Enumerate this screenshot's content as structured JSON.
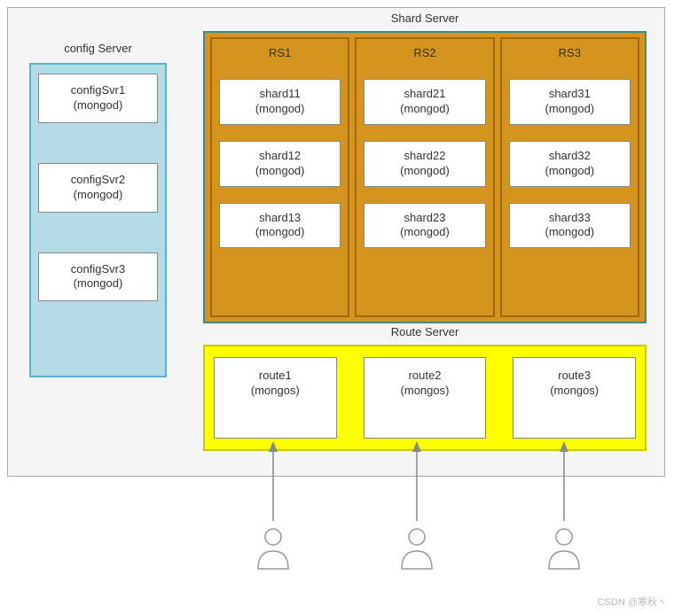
{
  "sections": {
    "config_title": "config Server",
    "shard_title": "Shard Server",
    "route_title": "Route Server"
  },
  "config_servers": [
    {
      "name": "configSvr1",
      "proc": "(mongod)"
    },
    {
      "name": "configSvr2",
      "proc": "(mongod)"
    },
    {
      "name": "configSvr3",
      "proc": "(mongod)"
    }
  ],
  "replica_sets": [
    {
      "label": "RS1",
      "shards": [
        {
          "name": "shard11",
          "proc": "(mongod)"
        },
        {
          "name": "shard12",
          "proc": "(mongod)"
        },
        {
          "name": "shard13",
          "proc": "(mongod)"
        }
      ]
    },
    {
      "label": "RS2",
      "shards": [
        {
          "name": "shard21",
          "proc": "(mongod)"
        },
        {
          "name": "shard22",
          "proc": "(mongod)"
        },
        {
          "name": "shard23",
          "proc": "(mongod)"
        }
      ]
    },
    {
      "label": "RS3",
      "shards": [
        {
          "name": "shard31",
          "proc": "(mongod)"
        },
        {
          "name": "shard32",
          "proc": "(mongod)"
        },
        {
          "name": "shard33",
          "proc": "(mongod)"
        }
      ]
    }
  ],
  "routes": [
    {
      "name": "route1",
      "proc": "(mongos)"
    },
    {
      "name": "route2",
      "proc": "(mongos)"
    },
    {
      "name": "route3",
      "proc": "(mongos)"
    }
  ],
  "watermark": "CSDN @寒秋丶"
}
